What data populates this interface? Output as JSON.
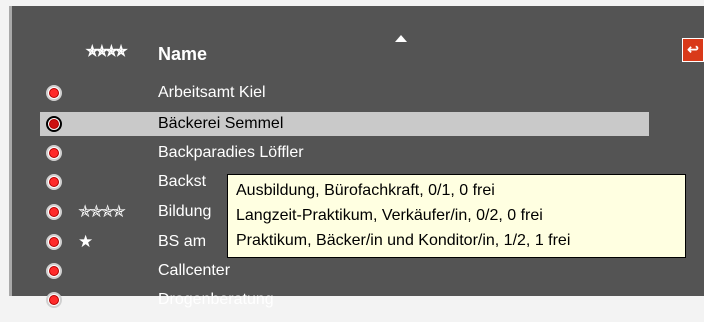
{
  "header": {
    "stars": "✯✯✯✯",
    "column_title": "Name",
    "sort_icon": "sort-ascending-icon",
    "exit_icon": "exit-door-icon"
  },
  "rows": [
    {
      "label": "Arbeitsamt Kiel",
      "stars": "",
      "selected": false
    },
    {
      "label": "Bäckerei Semmel",
      "stars": "",
      "selected": true
    },
    {
      "label": "Backparadies Löffler",
      "stars": "",
      "selected": false
    },
    {
      "label": "Backst",
      "stars": "",
      "selected": false
    },
    {
      "label": "Bildung",
      "stars": "✯✯✯✯",
      "selected": false
    },
    {
      "label": "BS am",
      "stars": "★",
      "selected": false
    },
    {
      "label": "Callcenter",
      "stars": "",
      "selected": false
    },
    {
      "label": "Drogenberatung",
      "stars": "",
      "selected": false
    }
  ],
  "tooltip": {
    "lines": [
      "Ausbildung, Bürofachkraft, 0/1, 0 frei",
      "Langzeit-Praktikum, Verkäufer/in, 0/2, 0 frei",
      "Praktikum, Bäcker/in und Konditor/in, 1/2, 1 frei"
    ]
  },
  "colors": {
    "panel": "#545454",
    "selection": "#c9c9c9",
    "tooltip": "#ffffe1",
    "radio": "#ff2a2a"
  }
}
